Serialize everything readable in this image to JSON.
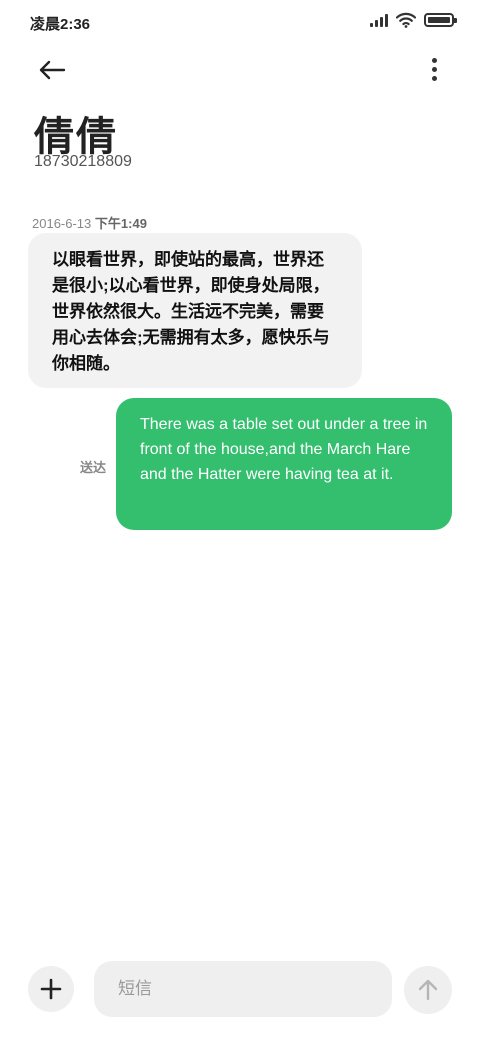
{
  "status_bar": {
    "time": "凌晨2:36",
    "icons": [
      "signal-icon",
      "wifi-icon",
      "battery-icon"
    ]
  },
  "header": {
    "back_icon": "arrow-left-icon",
    "more_icon": "more-vertical-icon"
  },
  "contact": {
    "name": "倩倩",
    "number": "18730218809"
  },
  "conversation": {
    "timestamp_date": "2016-6-13",
    "timestamp_time": "下午1:49",
    "received_message": "以眼看世界，即使站的最高，世界还是很小;以心看世界，即使身处局限，世界依然很大。生活远不完美，需要用心去体会;无需拥有太多，愿快乐与你相随。",
    "sent_message": "There was a table set out under a tree in front of the house,and the March Hare and the Hatter were having tea at it.",
    "sent_status": "送达"
  },
  "composer": {
    "placeholder": "短信",
    "value": "",
    "attach_icon": "plus-icon",
    "send_icon": "arrow-up-icon"
  },
  "colors": {
    "sent_bubble": "#33bf6e",
    "received_bubble": "#f2f2f2",
    "input_background": "#efefef"
  }
}
